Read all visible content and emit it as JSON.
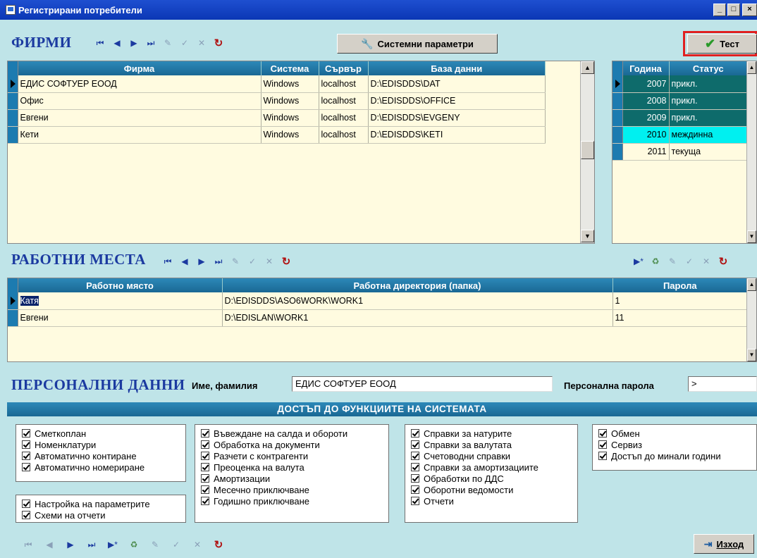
{
  "window": {
    "title": "Регистрирани потребители",
    "controls": [
      "_",
      "□",
      "×"
    ]
  },
  "firms": {
    "title": "ФИРМИ",
    "system_params_label": "Системни параметри",
    "test_label": "Тест",
    "columns": [
      "Фирма",
      "Система",
      "Сървър",
      "База данни"
    ],
    "rows": [
      [
        "ЕДИС СОФТУЕР ЕООД",
        "Windows",
        "localhost",
        "D:\\EDISDDS\\DAT"
      ],
      [
        "Офис",
        "Windows",
        "localhost",
        "D:\\EDISDDS\\OFFICE"
      ],
      [
        "Евгени",
        "Windows",
        "localhost",
        "D:\\EDISDDS\\EVGENY"
      ],
      [
        "Кети",
        "Windows",
        "localhost",
        "D:\\EDISDDS\\KETI"
      ]
    ],
    "years_columns": [
      "Година",
      "Статус"
    ],
    "years": [
      {
        "year": "2007",
        "status": "прикл.",
        "color": "#0e6b6b"
      },
      {
        "year": "2008",
        "status": "прикл.",
        "color": "#0e6b6b"
      },
      {
        "year": "2009",
        "status": "прикл.",
        "color": "#0e6b6b"
      },
      {
        "year": "2010",
        "status": "междинна",
        "color": "#00f0f0"
      },
      {
        "year": "2011",
        "status": "текуща",
        "color": "#fffbe0"
      }
    ]
  },
  "workplaces": {
    "title": "РАБОТНИ МЕСТА",
    "columns": [
      "Работно място",
      "Работна директория (папка)",
      "Парола"
    ],
    "rows": [
      [
        "Катя",
        "D:\\EDISDDS\\ASO6WORK\\WORK1",
        "1"
      ],
      [
        "Евгени",
        "D:\\EDISLAN\\WORK1",
        "11"
      ]
    ]
  },
  "personal": {
    "title": "ПЕРСОНАЛНИ ДАННИ",
    "name_label": "Име, фамилия",
    "name_value": "ЕДИС СОФТУЕР ЕООД",
    "password_label": "Персонална парола",
    "password_value": ">"
  },
  "access": {
    "title": "ДОСТЪП ДО ФУНКЦИИТЕ НА СИСТЕМАТА",
    "group1a": [
      "Сметкоплан",
      "Номенклатури",
      "Автоматично контиране",
      "Автоматично номериране"
    ],
    "group1b": [
      "Настройка на параметрите",
      "Схеми на отчети"
    ],
    "group2": [
      "Въвеждане на салда и обороти",
      "Обработка на документи",
      "Разчети с контрагенти",
      "Преоценка на валута",
      "Амортизации",
      "Месечно приключване",
      "Годишно приключване"
    ],
    "group3": [
      "Справки за натурите",
      "Справки за валутата",
      "Счетоводни справки",
      "Справки за амортизациите",
      "Обработки по ДДС",
      "Оборотни ведомости",
      "Отчети"
    ],
    "group4": [
      "Обмен",
      "Сервиз",
      "Достъп до минали години"
    ]
  },
  "footer": {
    "exit_label": "Изход"
  },
  "colors": {
    "accent_blue": "#1b3aa0",
    "header_teal": "#1a6894",
    "background": "#bfe4e8",
    "highlight_red": "#e02020"
  },
  "icons": [
    "first-icon",
    "prev-icon",
    "next-icon",
    "last-icon",
    "insert-icon",
    "edit-icon",
    "post-icon",
    "cancel-icon",
    "refresh-icon",
    "delete-icon",
    "wrench-icon",
    "check-icon",
    "exit-icon"
  ]
}
